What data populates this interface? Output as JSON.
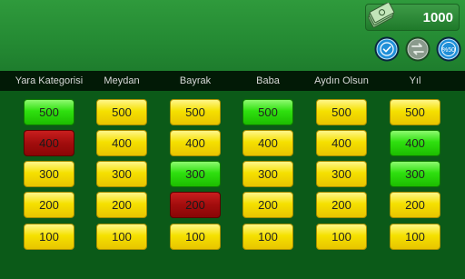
{
  "score": {
    "value": "1000"
  },
  "categories": [
    {
      "name": "Yara Kategorisi",
      "tiles": [
        {
          "label": "500",
          "color": "green"
        },
        {
          "label": "400",
          "color": "red"
        },
        {
          "label": "300",
          "color": "yellow"
        },
        {
          "label": "200",
          "color": "yellow"
        },
        {
          "label": "100",
          "color": "yellow"
        }
      ]
    },
    {
      "name": "Meydan",
      "tiles": [
        {
          "label": "500",
          "color": "yellow"
        },
        {
          "label": "400",
          "color": "yellow"
        },
        {
          "label": "300",
          "color": "yellow"
        },
        {
          "label": "200",
          "color": "yellow"
        },
        {
          "label": "100",
          "color": "yellow"
        }
      ]
    },
    {
      "name": "Bayrak",
      "tiles": [
        {
          "label": "500",
          "color": "yellow"
        },
        {
          "label": "400",
          "color": "yellow"
        },
        {
          "label": "300",
          "color": "green"
        },
        {
          "label": "200",
          "color": "red"
        },
        {
          "label": "100",
          "color": "yellow"
        }
      ]
    },
    {
      "name": "Baba",
      "tiles": [
        {
          "label": "500",
          "color": "green"
        },
        {
          "label": "400",
          "color": "yellow"
        },
        {
          "label": "300",
          "color": "yellow"
        },
        {
          "label": "200",
          "color": "yellow"
        },
        {
          "label": "100",
          "color": "yellow"
        }
      ]
    },
    {
      "name": "Aydın Olsun",
      "tiles": [
        {
          "label": "500",
          "color": "yellow"
        },
        {
          "label": "400",
          "color": "yellow"
        },
        {
          "label": "300",
          "color": "yellow"
        },
        {
          "label": "200",
          "color": "yellow"
        },
        {
          "label": "100",
          "color": "yellow"
        }
      ]
    },
    {
      "name": "Yıl",
      "tiles": [
        {
          "label": "500",
          "color": "yellow"
        },
        {
          "label": "400",
          "color": "green"
        },
        {
          "label": "300",
          "color": "green"
        },
        {
          "label": "200",
          "color": "yellow"
        },
        {
          "label": "100",
          "color": "yellow"
        }
      ]
    }
  ],
  "joker_buttons": [
    {
      "icon": "check-icon",
      "state": "active"
    },
    {
      "icon": "swap-icon",
      "state": "disabled"
    },
    {
      "icon": "fifty-fifty-icon",
      "label": "%50",
      "state": "active"
    }
  ],
  "colors": {
    "background": "#0b5a18",
    "top_panel": "#248a33",
    "header_bar": "#021a06",
    "tile_yellow": "#f5e100",
    "tile_green": "#2fe00f",
    "tile_red": "#a20d0d"
  }
}
